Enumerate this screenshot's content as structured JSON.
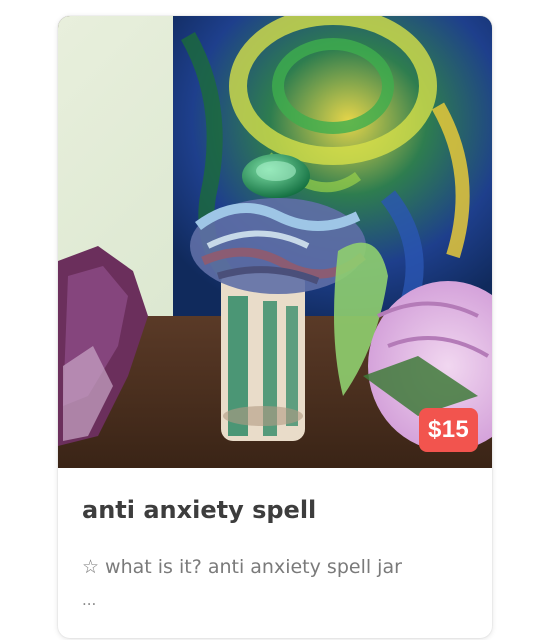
{
  "listing": {
    "title": "anti anxiety spell",
    "price": "$15",
    "star_glyph": "☆",
    "description": "what is it? anti anxiety spell jar",
    "ellipsis": "..."
  },
  "colors": {
    "price_badge": "#f2544e",
    "title_text": "#3d3d3d",
    "description_text": "#7a7a7a"
  }
}
